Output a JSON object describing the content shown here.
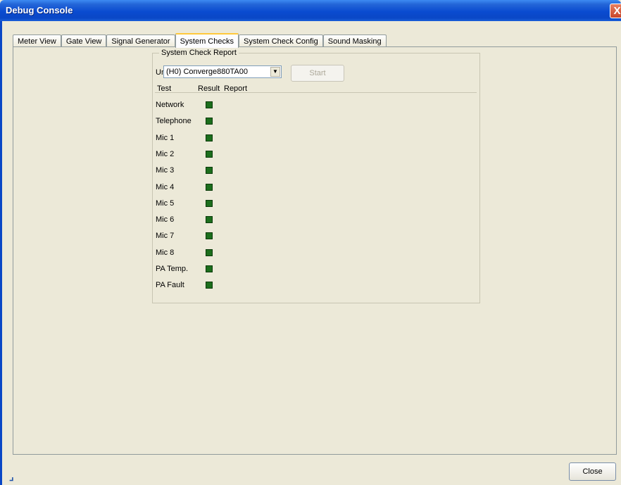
{
  "window": {
    "title": "Debug Console",
    "close_glyph": "X"
  },
  "tabs": [
    {
      "label": "Meter View",
      "active": false
    },
    {
      "label": "Gate View",
      "active": false
    },
    {
      "label": "Signal Generator",
      "active": false
    },
    {
      "label": "System Checks",
      "active": true
    },
    {
      "label": "System Check Config",
      "active": false
    },
    {
      "label": "Sound Masking",
      "active": false
    }
  ],
  "report": {
    "group_title": "System Check Report",
    "unit_label": "Unit",
    "unit_value": "(H0) Converge880TA00",
    "start_label": "Start",
    "headers": {
      "test": "Test",
      "result": "Result",
      "report": "Report"
    },
    "rows": [
      {
        "test": "Network",
        "result_color": "#1c6e1c"
      },
      {
        "test": "Telephone",
        "result_color": "#1c6e1c"
      },
      {
        "test": "Mic 1",
        "result_color": "#1c6e1c"
      },
      {
        "test": "Mic 2",
        "result_color": "#1c6e1c"
      },
      {
        "test": "Mic 3",
        "result_color": "#1c6e1c"
      },
      {
        "test": "Mic 4",
        "result_color": "#1c6e1c"
      },
      {
        "test": "Mic 5",
        "result_color": "#1c6e1c"
      },
      {
        "test": "Mic 6",
        "result_color": "#1c6e1c"
      },
      {
        "test": "Mic 7",
        "result_color": "#1c6e1c"
      },
      {
        "test": "Mic 8",
        "result_color": "#1c6e1c"
      },
      {
        "test": "PA Temp.",
        "result_color": "#1c6e1c"
      },
      {
        "test": "PA Fault",
        "result_color": "#1c6e1c"
      }
    ]
  },
  "footer": {
    "close_label": "Close",
    "grip_icon": "resize-grip-icon"
  }
}
